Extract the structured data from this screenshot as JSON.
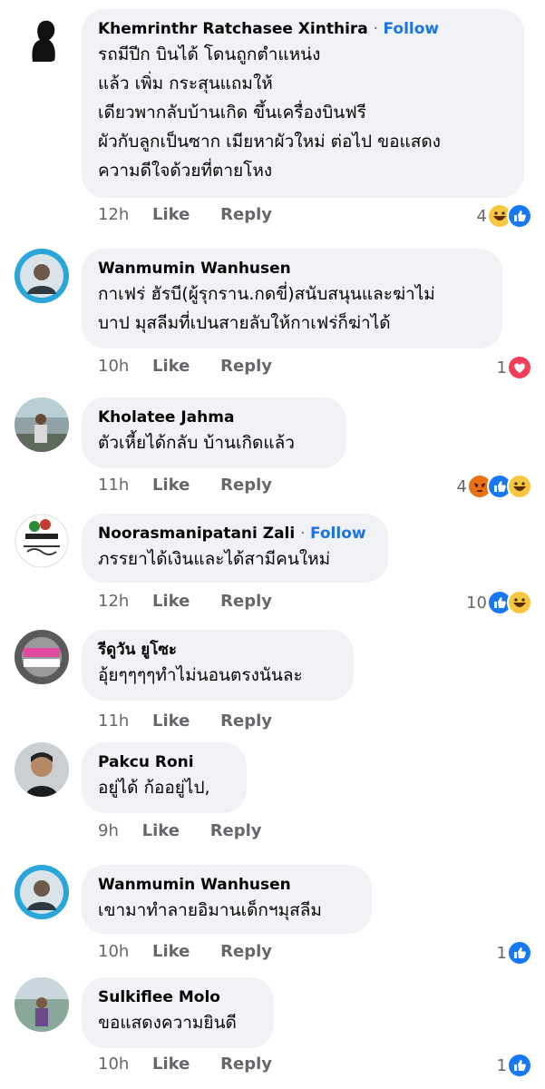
{
  "comments": [
    {
      "author": "Khemrinthr Ratchasee Xinthira",
      "follow": "Follow",
      "text": "รถมีปีก บินได้ โดนถูกตำแหน่ง\nแล้ว เพิ่ม กระสุนแถมให้\nเดียวพากลับบ้านเกิด ขึ้นเครื่องบินฟรี\nผัวกับลูกเป็นซาก  เมียหาผัวใหม่ ต่อไป ขอแสดง\nความดีใจด้วยที่ตายโหง",
      "time": "12h",
      "like": "Like",
      "reply": "Reply",
      "reaction_count": "4",
      "reactions": [
        "haha-icon",
        "like-icon"
      ]
    },
    {
      "author": "Wanmumin Wanhusen",
      "text": "กาเฟร่ ฮัรบี(ผู้รุกราน.กดขี่)สนับสนุนและฆ่าไม่\nบาป มุสลีมที่เปนสายลับให้กาเฟร่ก็ฆ่าได้",
      "time": "10h",
      "like": "Like",
      "reply": "Reply",
      "reaction_count": "1",
      "reactions": [
        "love-icon"
      ]
    },
    {
      "author": "Kholatee Jahma",
      "text": "ตัวเหี้ยได้กลับ บ้านเกิดแล้ว",
      "time": "11h",
      "like": "Like",
      "reply": "Reply",
      "reaction_count": "4",
      "reactions": [
        "angry-icon",
        "like-icon",
        "haha-icon"
      ]
    },
    {
      "author": "Noorasmanipatani Zali",
      "follow": "Follow",
      "text": "ภรรยาได้เงินและได้สามีคนใหม่",
      "time": "12h",
      "like": "Like",
      "reply": "Reply",
      "reaction_count": "10",
      "reactions": [
        "like-icon",
        "haha-icon"
      ]
    },
    {
      "author": "รีดูวัน ยูโซะ",
      "text": "อุ้ยๆๆๆๆทำไม่นอนตรงนันละ",
      "time": "11h",
      "like": "Like",
      "reply": "Reply",
      "reaction_count": "",
      "reactions": []
    },
    {
      "author": "Pakcu Roni",
      "text": "อยู่ได้ ก้ออยู่ไป,",
      "time": "9h",
      "like": "Like",
      "reply": "Reply",
      "reaction_count": "",
      "reactions": []
    },
    {
      "author": "Wanmumin Wanhusen",
      "text": "เขามาทำลายอิมานเด็กฯมุสลีม",
      "time": "10h",
      "like": "Like",
      "reply": "Reply",
      "reaction_count": "1",
      "reactions": [
        "like-icon"
      ]
    },
    {
      "author": "Sulkiflee Molo",
      "text": "ขอแสดงความยินดี",
      "time": "10h",
      "like": "Like",
      "reply": "Reply",
      "reaction_count": "1",
      "reactions": [
        "like-icon"
      ]
    }
  ],
  "colors": {
    "bubble": "#f0f2f5",
    "follow": "#1b74e4",
    "meta": "#65676b",
    "like": "#1877f2",
    "haha": "#f7c640",
    "angry": "#e9710f",
    "love": "#f33e58"
  }
}
